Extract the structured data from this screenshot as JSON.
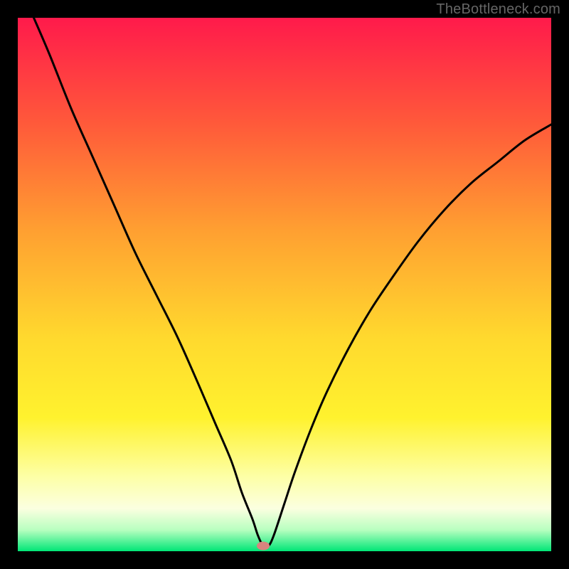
{
  "watermark": "TheBottleneck.com",
  "chart_data": {
    "type": "line",
    "title": "",
    "xlabel": "",
    "ylabel": "",
    "xlim": [
      0,
      100
    ],
    "ylim": [
      0,
      100
    ],
    "grid": false,
    "series": [
      {
        "name": "curve",
        "x": [
          3,
          6,
          10,
          14,
          18,
          22,
          26,
          30,
          34,
          37,
          40,
          42,
          44,
          45,
          46,
          47,
          48,
          50,
          52,
          55,
          58,
          62,
          66,
          70,
          75,
          80,
          85,
          90,
          95,
          100
        ],
        "y": [
          100,
          93,
          83,
          74,
          65,
          56,
          48,
          40,
          31,
          24,
          17,
          11,
          6,
          3,
          1,
          1,
          3,
          9,
          15,
          23,
          30,
          38,
          45,
          51,
          58,
          64,
          69,
          73,
          77,
          80
        ]
      }
    ],
    "gradient_stops": [
      {
        "offset": 0.0,
        "color": "#ff1a4b"
      },
      {
        "offset": 0.2,
        "color": "#ff5a3a"
      },
      {
        "offset": 0.4,
        "color": "#ffa031"
      },
      {
        "offset": 0.6,
        "color": "#ffd92e"
      },
      {
        "offset": 0.75,
        "color": "#fff22e"
      },
      {
        "offset": 0.86,
        "color": "#fdffa6"
      },
      {
        "offset": 0.92,
        "color": "#fbffe0"
      },
      {
        "offset": 0.96,
        "color": "#b8ffc0"
      },
      {
        "offset": 1.0,
        "color": "#00e676"
      }
    ],
    "marker": {
      "x": 46,
      "y": 1,
      "color": "#d8847e"
    }
  }
}
